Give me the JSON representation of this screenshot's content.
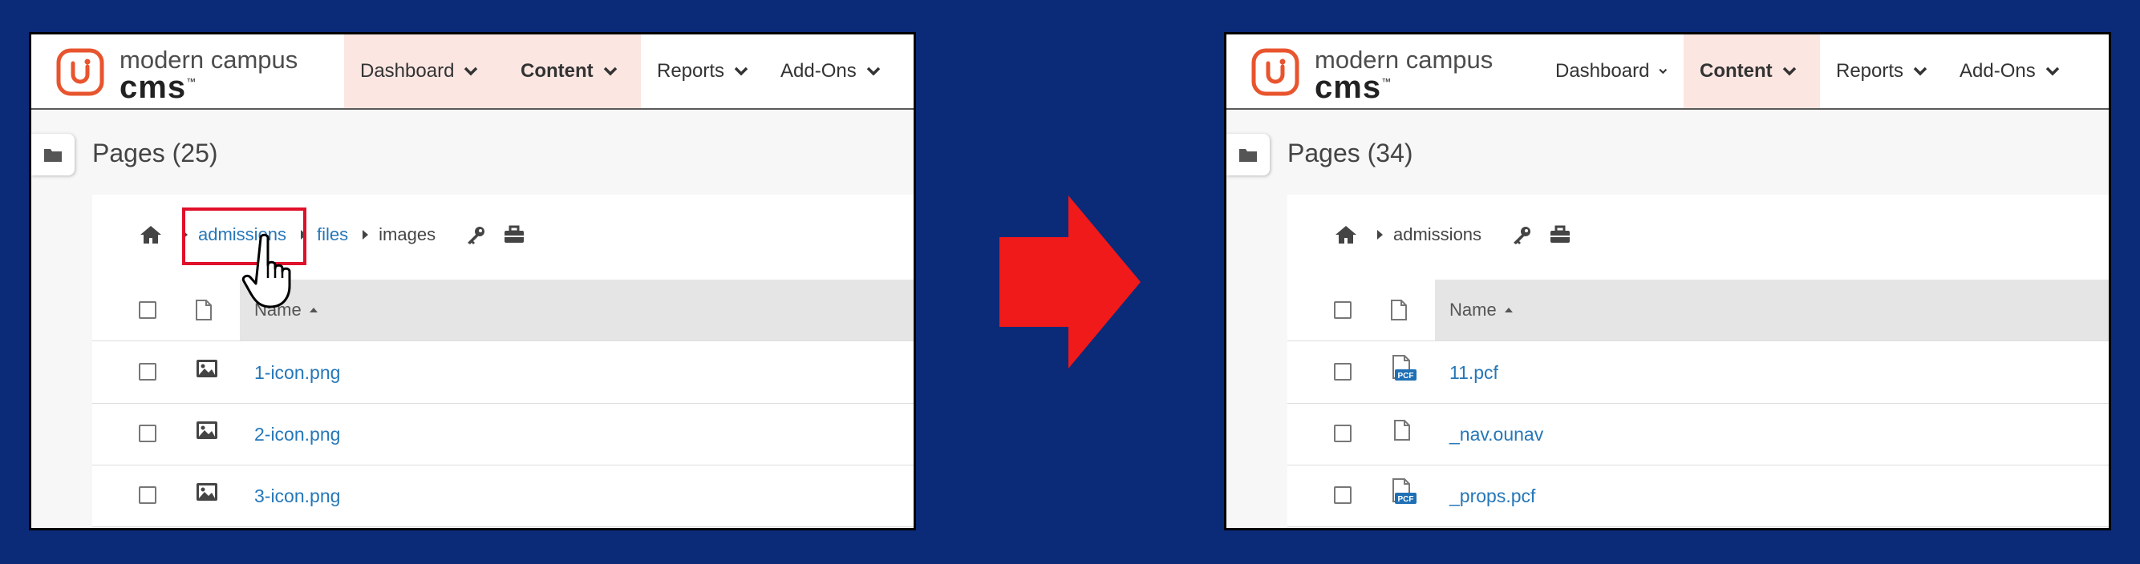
{
  "colors": {
    "background": "#0b2a78",
    "accent": "#e8542e",
    "link": "#2577b8",
    "highlight": "#e0102a",
    "arrow": "#f01a1a"
  },
  "logo": {
    "line1": "modern campus",
    "line2": "cms",
    "tm": "™"
  },
  "nav": {
    "dashboard": "Dashboard",
    "content": "Content",
    "reports": "Reports",
    "addons": "Add-Ons"
  },
  "left": {
    "title": "Pages (25)",
    "breadcrumb": {
      "crumb1": "admissions",
      "crumb2": "files",
      "crumb3": "images"
    },
    "column_header": "Name",
    "rows": [
      {
        "name": "1-icon.png",
        "icon": "image-icon"
      },
      {
        "name": "2-icon.png",
        "icon": "image-icon"
      },
      {
        "name": "3-icon.png",
        "icon": "image-icon"
      }
    ]
  },
  "right": {
    "title": "Pages (34)",
    "breadcrumb": {
      "crumb1": "admissions"
    },
    "column_header": "Name",
    "rows": [
      {
        "name": "11.pcf",
        "icon": "pcf-file-icon",
        "badge": "PCF"
      },
      {
        "name": "_nav.ounav",
        "icon": "file-icon"
      },
      {
        "name": "_props.pcf",
        "icon": "pcf-file-icon",
        "badge": "PCF"
      }
    ]
  }
}
